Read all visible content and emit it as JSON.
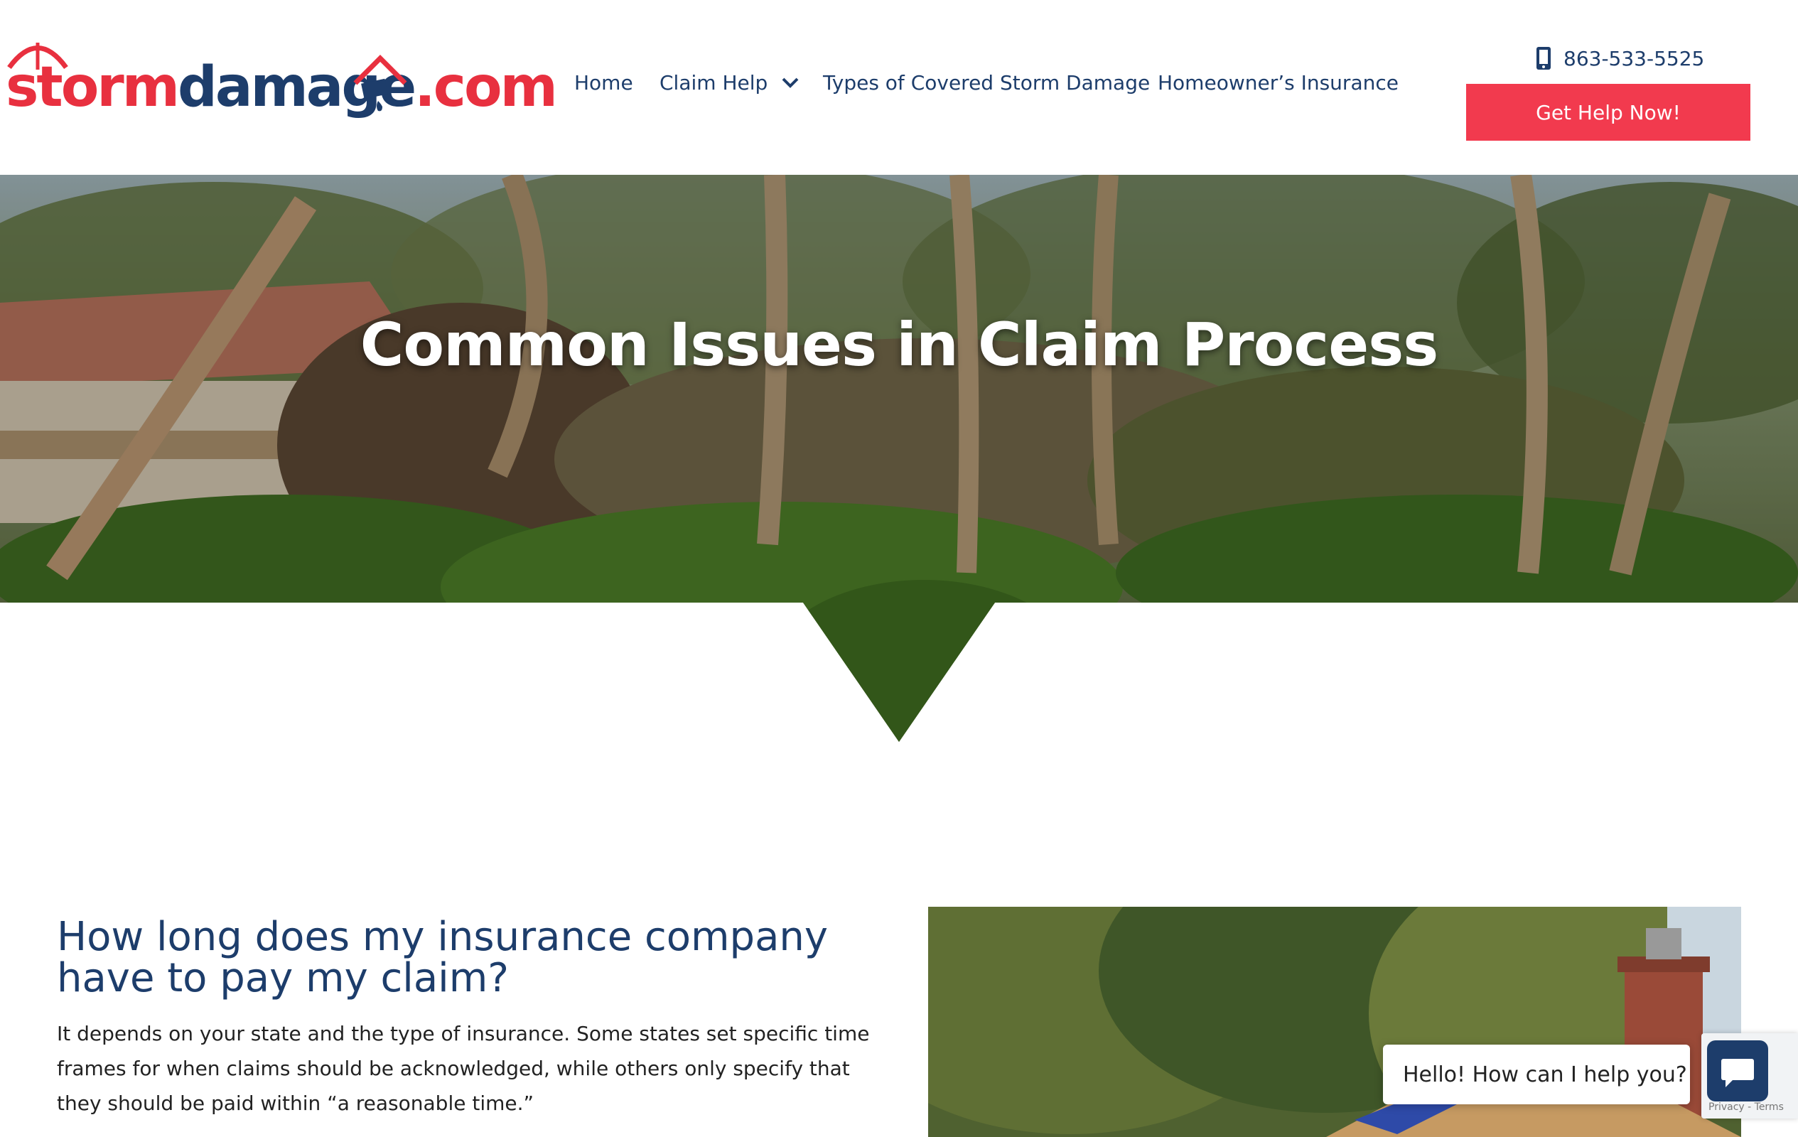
{
  "header": {
    "logo": {
      "part1": "storm",
      "part2": "damage",
      "part3": ".com"
    },
    "nav": [
      {
        "label": "Home"
      },
      {
        "label": "Claim Help"
      },
      {
        "label": "Types of Covered Storm Damage"
      },
      {
        "label": "Homeowner’s Insurance"
      }
    ],
    "phone": "863-533-5525",
    "cta_label": "Get Help Now!"
  },
  "hero": {
    "title": "Common Issues in Claim Process"
  },
  "content": {
    "heading": "How long does my insurance company have to pay my claim?",
    "body": "It depends on your state and the type of insurance. Some states set specific time frames for when claims should be acknowledged, while others only specify that they should be paid within “a reasonable time.”"
  },
  "chat": {
    "greeting": "Hello! How can I help you?",
    "recaptcha": "Privacy - Terms"
  },
  "colors": {
    "brand_navy": "#1d3d6b",
    "brand_red": "#e8303f",
    "cta_red": "#f23a4e"
  },
  "icons": {
    "phone": "mobile-phone-icon",
    "chevron": "chevron-down-icon",
    "chat": "chat-icon"
  }
}
